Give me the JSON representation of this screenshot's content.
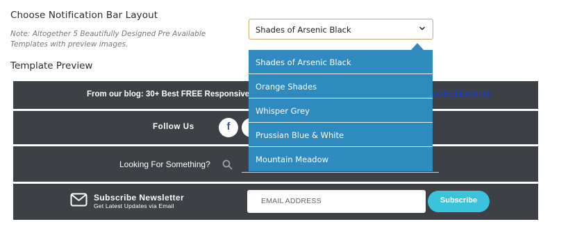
{
  "layout_field": {
    "label": "Choose Notification Bar Layout",
    "note": "Note: Altogether 5 Beautifully Designed Pre Available Templates with preview images.",
    "selected": "Shades of Arsenic Black",
    "options": [
      "Shades of Arsenic Black",
      "Orange Shades",
      "Whisper Grey",
      "Prussian Blue & White",
      "Mountain Meadow"
    ]
  },
  "preview": {
    "title": "Template Preview",
    "blog_bar": {
      "text": "From our blog: 30+ Best FREE Responsive W",
      "link": "o/kBGhEwXm8u"
    },
    "follow_bar": {
      "text": "Follow Us",
      "facebook_glyph": "f"
    },
    "search_bar": {
      "text": "Looking For Something?"
    },
    "subscribe_bar": {
      "title": "Subscribe Newsletter",
      "subtitle": "Get Latest Updates via Email",
      "email_placeholder": "EMAIL ADDRESS",
      "button": "Subscribe"
    }
  },
  "colors": {
    "dropdown_bg": "#2f8bbf",
    "bar_bg": "#3d4045",
    "accent": "#3cc3dc",
    "select_border": "#c9a86a"
  },
  "icons": [
    "chevron-down-icon",
    "facebook-icon",
    "search-icon",
    "mail-icon"
  ]
}
